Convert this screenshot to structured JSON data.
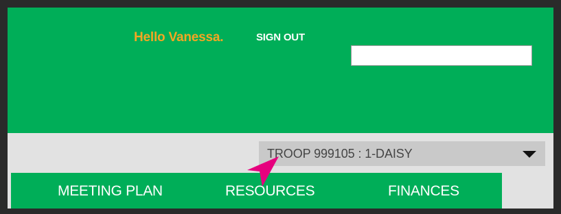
{
  "header": {
    "greeting": "Hello Vanessa.",
    "sign_out_label": "SIGN OUT",
    "search": {
      "value": "",
      "placeholder": ""
    }
  },
  "troop_selector": {
    "selected": "TROOP 999105 : 1-DAISY",
    "icon": "caret-down-icon"
  },
  "nav": {
    "items": [
      {
        "label": "MEETING PLAN"
      },
      {
        "label": "RESOURCES"
      },
      {
        "label": "FINANCES"
      }
    ]
  },
  "colors": {
    "brand_green": "#00ae58",
    "greeting_orange": "#f4a623",
    "pointer_magenta": "#e6007e",
    "selector_gray": "#c9c9c9"
  },
  "annotation": {
    "icon": "cursor-arrow-icon"
  }
}
